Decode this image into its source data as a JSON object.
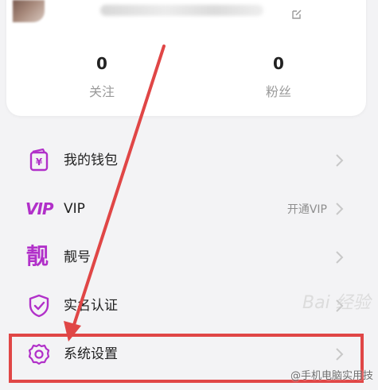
{
  "profile": {
    "stats": [
      {
        "value": "0",
        "label": "关注"
      },
      {
        "value": "0",
        "label": "粉丝"
      }
    ]
  },
  "menu": [
    {
      "label": "我的钱包",
      "icon": "wallet-icon",
      "extra": ""
    },
    {
      "label": "VIP",
      "icon": "vip-icon",
      "logo": "VIP",
      "extra": "开通VIP"
    },
    {
      "label": "靓号",
      "icon": "pretty-number-icon",
      "logo": "靓",
      "extra": ""
    },
    {
      "label": "实名认证",
      "icon": "shield-check-icon",
      "extra": ""
    },
    {
      "label": "系统设置",
      "icon": "gear-icon",
      "extra": ""
    }
  ],
  "watermark": {
    "brand": "Bai 经验",
    "text": "@手机电脑实用技"
  },
  "colors": {
    "accent": "#b130c9",
    "annotation": "#e04646",
    "background": "#f3f3f5",
    "card": "#ffffff"
  }
}
